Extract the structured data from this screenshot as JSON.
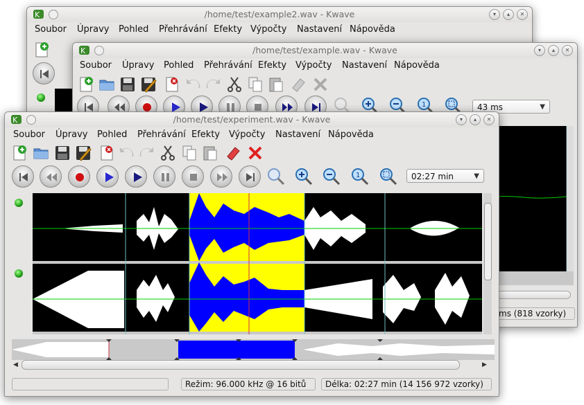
{
  "windows": {
    "back": {
      "title": "/home/test/example2.wav - Kwave",
      "menu": [
        "Soubor",
        "Úpravy",
        "Pohled",
        "Přehrávání",
        "Efekty",
        "Výpočty",
        "Nastavení",
        "Nápověda"
      ]
    },
    "middle": {
      "title": "/home/test/example.wav - Kwave",
      "menu": [
        "Soubor",
        "Úpravy",
        "Pohled",
        "Přehrávání",
        "Efekty",
        "Výpočty",
        "Nastavení",
        "Nápověda"
      ],
      "zoom_value": "43 ms",
      "status_partial": "ms (818 vzorky)"
    },
    "front": {
      "title": "/home/test/experiment.wav - Kwave",
      "menu": [
        "Soubor",
        "Úpravy",
        "Pohled",
        "Přehrávání",
        "Efekty",
        "Výpočty",
        "Nastavení",
        "Nápověda"
      ],
      "zoom_value": "02:27 min",
      "status_mode": "Režim: 96.000 kHz @ 16 bitů",
      "status_length": "Délka: 02:27 min (14 156 972 vzorky)"
    }
  },
  "icons": {
    "toolbar": [
      "new-file-icon",
      "open-file-icon",
      "save-icon",
      "save-as-icon",
      "close-file-icon",
      "undo-icon",
      "redo-icon",
      "cut-icon",
      "copy-icon",
      "paste-icon",
      "erase-icon",
      "delete-icon"
    ],
    "transport": [
      "rewind-start-icon",
      "prev-icon",
      "record-icon",
      "play-icon",
      "loop-play-icon",
      "pause-icon",
      "stop-icon",
      "next-icon",
      "forward-end-icon"
    ],
    "zoom": [
      "zoom-selection-icon",
      "zoom-in-icon",
      "zoom-out-icon",
      "zoom-normal-icon",
      "zoom-all-icon"
    ]
  },
  "colors": {
    "selection": "#ffff00",
    "waveform": "#ffffff",
    "waveform_selected": "#0000ff",
    "zero_line": "#00cc00",
    "marker": "#70c0c0",
    "cursor": "#d03040",
    "background": "#000000"
  }
}
